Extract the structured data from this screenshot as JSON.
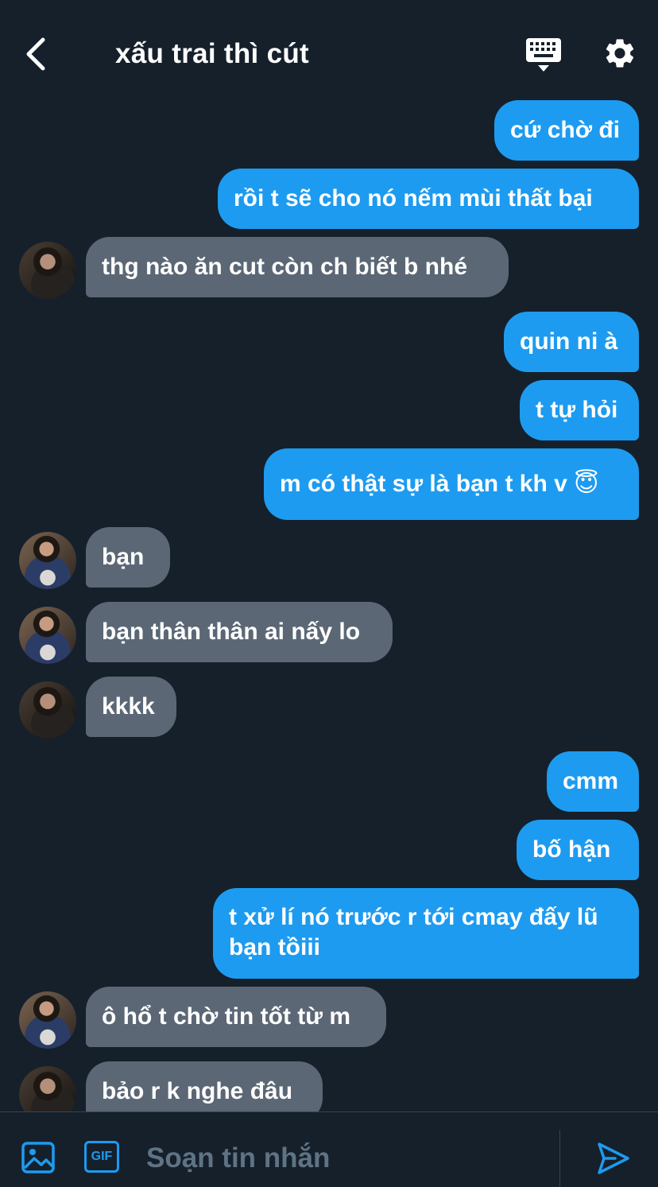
{
  "header": {
    "title": "xấu trai thì cút"
  },
  "messages": [
    {
      "dir": "sent",
      "text": "cứ chờ đi"
    },
    {
      "dir": "sent",
      "text": "rồi t sẽ cho nó nếm mùi thất bại"
    },
    {
      "dir": "recv",
      "text": "thg nào ăn cut còn ch biết b nhé"
    },
    {
      "dir": "sent",
      "text": "quin ni à"
    },
    {
      "dir": "sent",
      "text": "t tự hỏi"
    },
    {
      "dir": "sent",
      "text": "m có thật sự là bạn t kh v 😇"
    },
    {
      "dir": "recv",
      "text": "bạn"
    },
    {
      "dir": "recv",
      "text": "bạn thân thân ai nấy lo"
    },
    {
      "dir": "recv",
      "text": "kkkk"
    },
    {
      "dir": "sent",
      "text": "cmm"
    },
    {
      "dir": "sent",
      "text": "bố hận"
    },
    {
      "dir": "sent",
      "text": "t xử lí nó trước r tới cmay đấy lũ bạn tồiii"
    },
    {
      "dir": "recv",
      "text": "ô hổ t chờ tin tốt từ m"
    },
    {
      "dir": "recv",
      "text": "bảo r k nghe đâu"
    }
  ],
  "composer": {
    "gif_label": "GIF",
    "placeholder": "Soạn tin nhắn"
  },
  "colors": {
    "background": "#15202b",
    "sent_bubble": "#1d9bf0",
    "received_bubble": "#5b6775",
    "accent": "#1d9bf0"
  },
  "icons": [
    "back-arrow-icon",
    "keyboard-icon",
    "gear-icon",
    "image-icon",
    "gif-icon",
    "send-icon"
  ]
}
